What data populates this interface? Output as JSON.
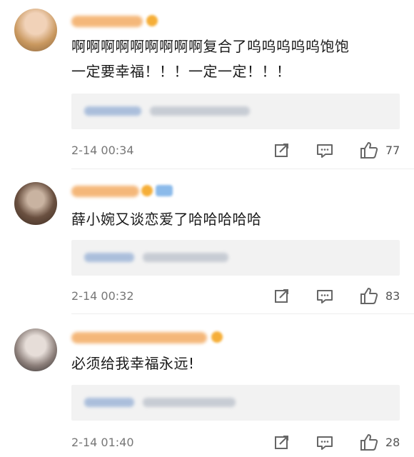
{
  "comments": [
    {
      "text_lines": [
        "啊啊啊啊啊啊啊啊啊复合了呜呜呜呜呜饱饱",
        "一定要幸福！！！一定一定！！！"
      ],
      "time": "2-14 00:34",
      "likes": "77",
      "avatar_icon": "avatar-photo"
    },
    {
      "text_lines": [
        "薛小婉又谈恋爱了哈哈哈哈哈"
      ],
      "time": "2-14 00:32",
      "likes": "83",
      "avatar_icon": "avatar-photo"
    },
    {
      "text_lines": [
        "必须给我幸福永远!"
      ],
      "time": "2-14 01:40",
      "likes": "28",
      "avatar_icon": "avatar-photo"
    }
  ],
  "icons": {
    "share": "share-icon",
    "reply": "reply-icon",
    "like": "thumbs-up-icon"
  },
  "colors": {
    "username": "#f5a623",
    "link_blurred": "#9fb6d8",
    "timestamp": "#777777"
  }
}
